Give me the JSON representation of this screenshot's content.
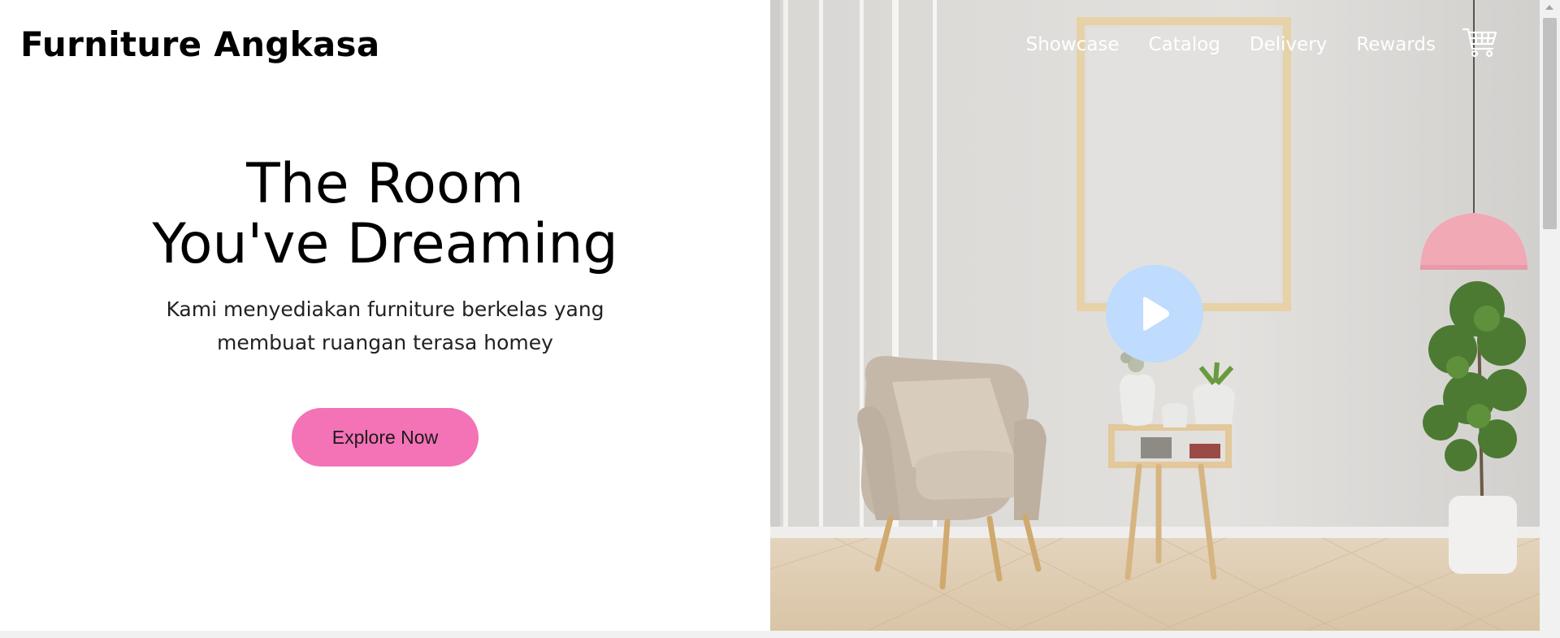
{
  "brand": {
    "name": "Furniture Angkasa"
  },
  "nav": {
    "items": [
      {
        "label": "Showcase"
      },
      {
        "label": "Catalog"
      },
      {
        "label": "Delivery"
      },
      {
        "label": "Rewards"
      }
    ],
    "cart_icon": "cart-icon"
  },
  "hero": {
    "title_line1": "The Room",
    "title_line2": "You've Dreaming",
    "subtitle_line1": "Kami menyediakan furniture berkelas yang",
    "subtitle_line2": "membuat ruangan terasa homey",
    "cta_label": "Explore Now"
  },
  "media": {
    "play_icon": "play-icon"
  },
  "colors": {
    "accent": "#f472b6",
    "play_bg": "#bfdbfe",
    "nav_text": "#ffffff"
  }
}
